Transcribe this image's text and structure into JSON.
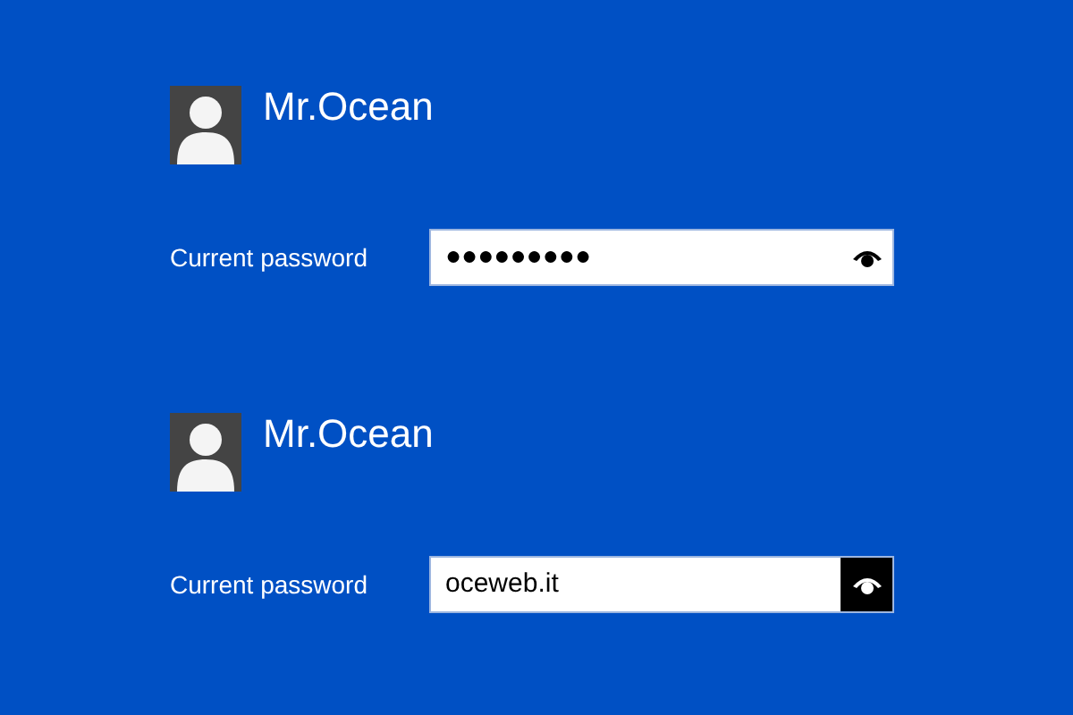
{
  "accounts": [
    {
      "user_name": "Mr.Ocean",
      "label": "Current password",
      "password": "●●●●●●●●●",
      "revealed": false
    },
    {
      "user_name": "Mr.Ocean",
      "label": "Current password",
      "password": "oceweb.it",
      "revealed": true
    }
  ]
}
